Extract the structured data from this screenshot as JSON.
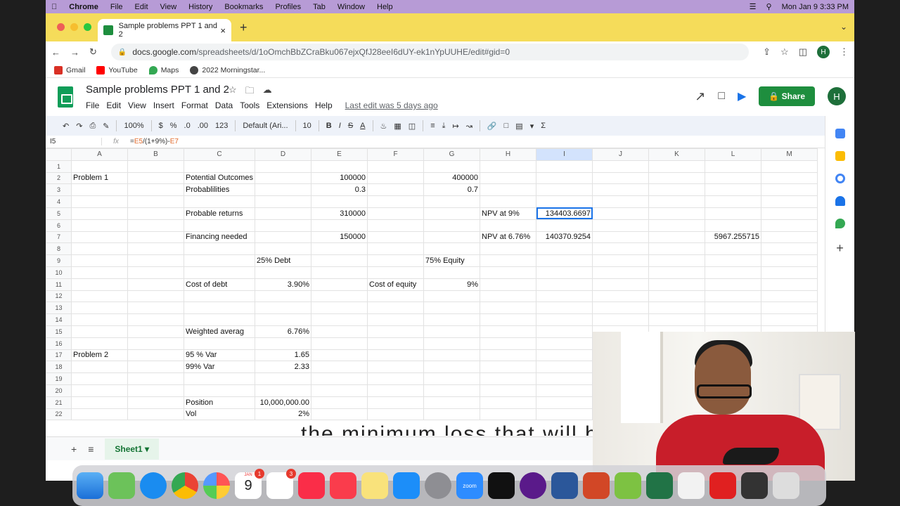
{
  "menubar": {
    "apple": "",
    "app": "Chrome",
    "items": [
      "File",
      "Edit",
      "View",
      "History",
      "Bookmarks",
      "Profiles",
      "Tab",
      "Window",
      "Help"
    ],
    "clock": "Mon Jan 9  3:33 PM"
  },
  "browser": {
    "tab_title": "Sample problems PPT 1 and 2",
    "url_domain": "docs.google.com",
    "url_path": "/spreadsheets/d/1oOmchBbZCraBku067ejxQfJ28eeI6dUY-ek1nYpUUHE/edit#gid=0",
    "profile": "H",
    "bookmarks": [
      {
        "label": "Gmail",
        "color": "#d93025"
      },
      {
        "label": "YouTube",
        "color": "#ff0000"
      },
      {
        "label": "Maps",
        "color": "#34a853"
      },
      {
        "label": "2022 Morningstar...",
        "color": "#444"
      }
    ]
  },
  "sheets": {
    "doc_title": "Sample problems PPT 1 and 2",
    "menu": [
      "File",
      "Edit",
      "View",
      "Insert",
      "Format",
      "Data",
      "Tools",
      "Extensions",
      "Help"
    ],
    "last_edit": "Last edit was 5 days ago",
    "share": "Share",
    "avatar": "H",
    "toolbar": {
      "zoom": "100%",
      "currency": "$",
      "percent": "%",
      "dec_minus": ".0",
      "dec_plus": ".00",
      "format": "123",
      "font": "Default (Ari...",
      "size": "10",
      "bold": "B",
      "italic": "I",
      "strike": "S",
      "textcolor": "A"
    },
    "namebox": "I5",
    "fx": "fx",
    "formula": {
      "p1": "=",
      "r1": "E5",
      "p2": "/(1+9%)-",
      "r2": "E7"
    },
    "columns": [
      "A",
      "B",
      "C",
      "D",
      "E",
      "F",
      "G",
      "H",
      "I",
      "J",
      "K",
      "L",
      "M"
    ],
    "rows": [
      [
        "",
        "",
        "",
        "",
        "",
        "",
        "",
        "",
        "",
        "",
        "",
        "",
        ""
      ],
      [
        "Problem 1",
        "",
        "Potential Outcomes",
        "",
        "100000",
        "",
        "400000",
        "",
        "",
        "",
        "",
        "",
        ""
      ],
      [
        "",
        "",
        "Probablilities",
        "",
        "0.3",
        "",
        "0.7",
        "",
        "",
        "",
        "",
        "",
        ""
      ],
      [
        "",
        "",
        "",
        "",
        "",
        "",
        "",
        "",
        "",
        "",
        "",
        "",
        ""
      ],
      [
        "",
        "",
        "Probable returns",
        "",
        "310000",
        "",
        "",
        "NPV at 9%",
        "134403.6697",
        "",
        "",
        "",
        ""
      ],
      [
        "",
        "",
        "",
        "",
        "",
        "",
        "",
        "",
        "",
        "",
        "",
        "",
        ""
      ],
      [
        "",
        "",
        "Financing needed",
        "",
        "150000",
        "",
        "",
        "NPV at 6.76%",
        "140370.9254",
        "",
        "",
        "5967.255715",
        ""
      ],
      [
        "",
        "",
        "",
        "",
        "",
        "",
        "",
        "",
        "",
        "",
        "",
        "",
        ""
      ],
      [
        "",
        "",
        "",
        "25% Debt",
        "",
        "",
        "75% Equity",
        "",
        "",
        "",
        "",
        "",
        ""
      ],
      [
        "",
        "",
        "",
        "",
        "",
        "",
        "",
        "",
        "",
        "",
        "",
        "",
        ""
      ],
      [
        "",
        "",
        "Cost of debt",
        "3.90%",
        "",
        "Cost of equity",
        "9%",
        "",
        "",
        "",
        "",
        "",
        ""
      ],
      [
        "",
        "",
        "",
        "",
        "",
        "",
        "",
        "",
        "",
        "",
        "",
        "",
        ""
      ],
      [
        "",
        "",
        "",
        "",
        "",
        "",
        "",
        "",
        "",
        "",
        "",
        "",
        ""
      ],
      [
        "",
        "",
        "",
        "",
        "",
        "",
        "",
        "",
        "",
        "",
        "",
        "",
        ""
      ],
      [
        "",
        "",
        "Weighted averag",
        "6.76%",
        "",
        "",
        "",
        "",
        "",
        "",
        "",
        "",
        ""
      ],
      [
        "",
        "",
        "",
        "",
        "",
        "",
        "",
        "",
        "",
        "",
        "",
        "",
        ""
      ],
      [
        "Problem 2",
        "",
        "95 % Var",
        "1.65",
        "",
        "",
        "",
        "",
        "",
        "",
        "",
        "",
        ""
      ],
      [
        "",
        "",
        "99% Var",
        "2.33",
        "",
        "",
        "",
        "",
        "",
        "",
        "",
        "",
        ""
      ],
      [
        "",
        "",
        "",
        "",
        "",
        "",
        "",
        "",
        "",
        "",
        "",
        "",
        ""
      ],
      [
        "",
        "",
        "",
        "",
        "",
        "",
        "",
        "",
        "",
        "",
        "",
        "",
        ""
      ],
      [
        "",
        "",
        "Position",
        "10,000,000.00",
        "",
        "",
        "",
        "",
        "",
        "",
        "",
        "",
        ""
      ],
      [
        "",
        "",
        "Vol",
        "2%",
        "",
        "",
        "",
        "",
        "",
        "",
        "",
        "",
        ""
      ]
    ],
    "sheet_tab": "Sheet1"
  },
  "caption": "the minimum loss that will be in",
  "dock": {
    "calendar_month": "JAN",
    "calendar_day": "9",
    "calendar_badge": "1",
    "reminders_badge": "3",
    "zoom_label": "zoom"
  }
}
